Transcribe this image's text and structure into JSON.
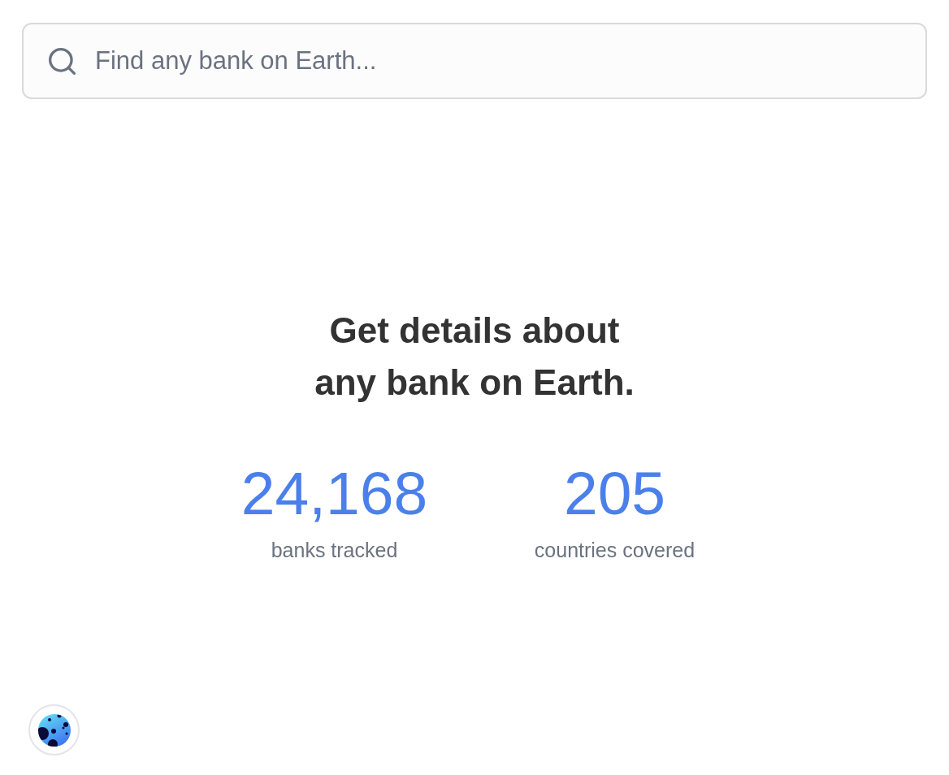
{
  "search": {
    "placeholder": "Find any bank on Earth..."
  },
  "hero": {
    "heading": "Get details about\nany bank on Earth."
  },
  "stats": [
    {
      "value": "24,168",
      "label": "banks tracked"
    },
    {
      "value": "205",
      "label": "countries covered"
    }
  ]
}
